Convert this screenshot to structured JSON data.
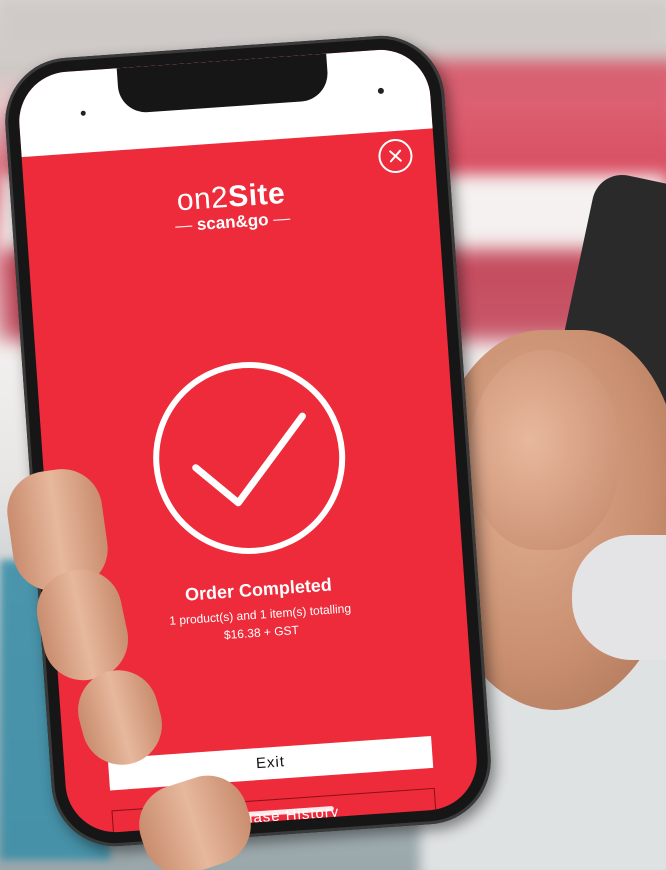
{
  "app": {
    "logo_prefix": "on2",
    "logo_brand": "Site",
    "logo_tagline": "scan&go",
    "logo_dash": "—"
  },
  "icons": {
    "close": "close-icon",
    "check": "check-circle-icon"
  },
  "order": {
    "title": "Order Completed",
    "summary_line": "1 product(s) and 1 item(s) totalling",
    "total_line": "$16.38 + GST"
  },
  "buttons": {
    "exit_label": "Exit",
    "history_label": "Purchase History"
  },
  "colors": {
    "brand_red": "#ed2b3b",
    "text_white": "#ffffff"
  }
}
